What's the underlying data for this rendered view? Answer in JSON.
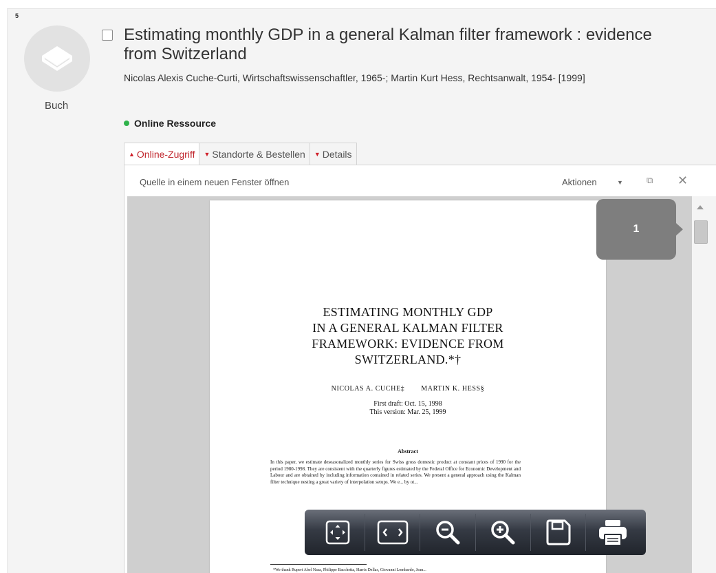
{
  "record": {
    "number": "5",
    "type_label": "Buch",
    "type_icon": "book-icon",
    "title": "Estimating monthly GDP in a general Kalman filter framework : evidence from Switzerland",
    "authors": "Nicolas Alexis Cuche-Curti, Wirtschaftswissenschaftler, 1965-; Martin Kurt Hess, Rechtsanwalt, 1954- [1999]",
    "availability": "Online Ressource",
    "availability_color": "#2fb24a"
  },
  "tabs": [
    {
      "label": "Online-Zugriff",
      "expanded": true
    },
    {
      "label": "Standorte & Bestellen",
      "expanded": false
    },
    {
      "label": "Details",
      "expanded": false
    }
  ],
  "viewer_bar": {
    "open_link": "Quelle in einem neuen Fenster öffnen",
    "actions_label": "Aktionen"
  },
  "pdf": {
    "title_lines": [
      "ESTIMATING MONTHLY GDP",
      "IN A GENERAL KALMAN FILTER",
      "FRAMEWORK: EVIDENCE FROM",
      "SWITZERLAND.*†"
    ],
    "author1": "NICOLAS A. CUCHE‡",
    "author2": "MARTIN K. HESS§",
    "date1": "First draft: Oct. 15, 1998",
    "date2": "This version: Mar. 25, 1999",
    "abstract_heading": "Abstract",
    "abstract_text": "In this paper, we estimate deseasonalized monthly series for Swiss gross domestic product at constant prices of 1990 for the period 1980-1998. They are consistent with the quarterly figures estimated by the Federal Office for Economic Development and Labour and are obtained by including information contained in related series. We present a general approach using the Kalman filter technique nesting a great variety of interpolation setups. We e... by ot...",
    "footnote": "*We thank Rupert Abel Nasa, Philippe Bacchetta, Harris Dellas, Giovanni Lombardo, Jean..."
  },
  "page_indicator": "1",
  "toolbar_icons": [
    "fit-page-icon",
    "fit-width-icon",
    "zoom-out-icon",
    "zoom-in-icon",
    "save-icon",
    "print-icon"
  ]
}
